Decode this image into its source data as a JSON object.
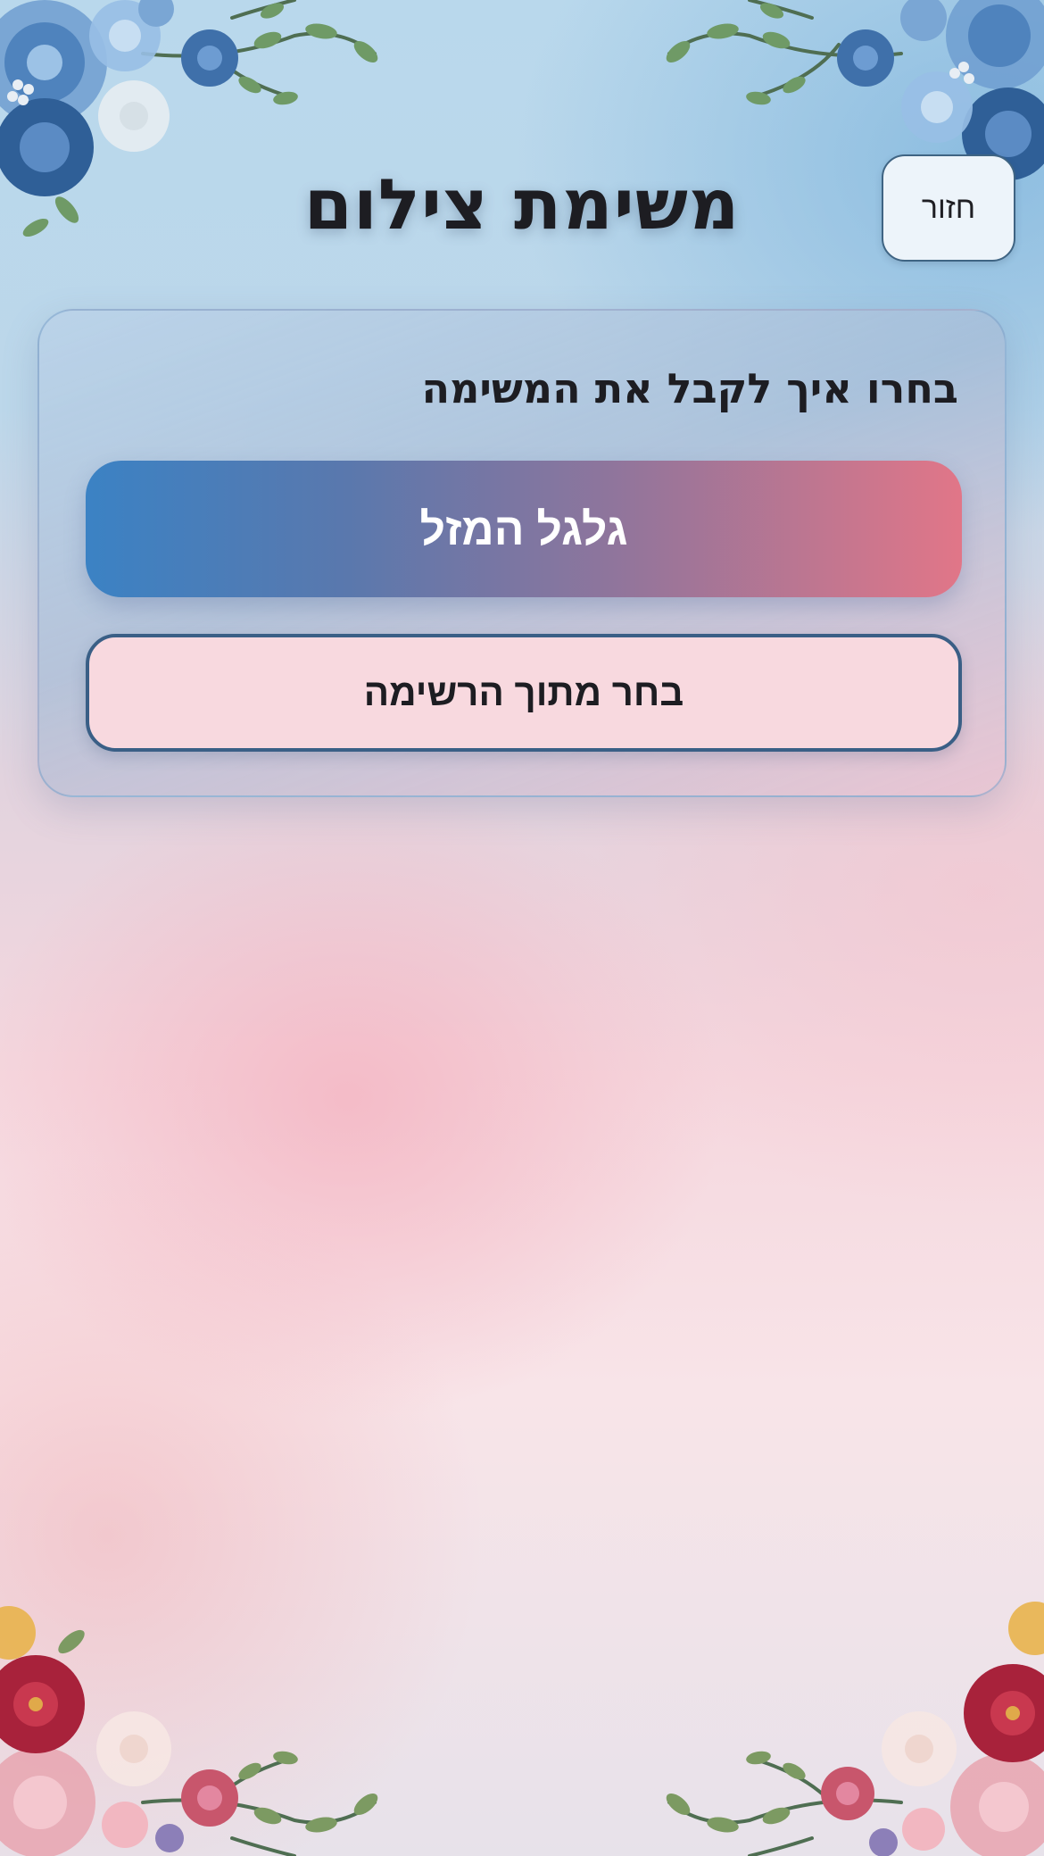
{
  "header": {
    "title": "משימת צילום",
    "back_label": "חזור"
  },
  "card": {
    "heading": "בחרו איך לקבל את המשימה",
    "wheel_button_label": "גלגל המזל",
    "list_button_label": "בחר מתוך הרשימה"
  },
  "decor": {
    "top_corners": "blue-flowers",
    "bottom_corners": "red-pink-flowers"
  }
}
